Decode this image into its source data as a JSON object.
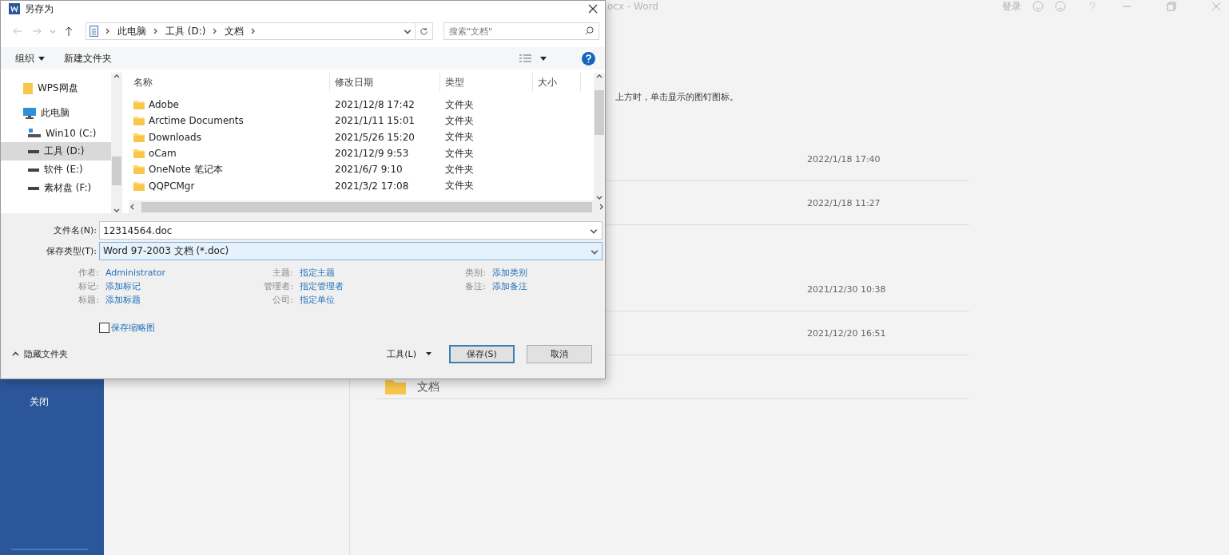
{
  "word_window": {
    "title": "ocx - Word",
    "sign_in": "登录",
    "hint": "上方时，单击显示的图钉图标。",
    "sidebar": {
      "items": [
        {
          "label": "关闭"
        }
      ]
    },
    "recent": [
      {
        "kind": "item",
        "date": "2022/1/18 17:40"
      },
      {
        "kind": "item",
        "date": "2022/1/18 11:27"
      },
      {
        "kind": "gap"
      },
      {
        "kind": "item",
        "date": "2021/12/30 10:38"
      },
      {
        "kind": "item",
        "date": "2021/12/20 16:51"
      },
      {
        "kind": "folder",
        "name": "文档"
      }
    ]
  },
  "dialog": {
    "title": "另存为",
    "breadcrumb": [
      "此电脑",
      "工具 (D:)",
      "文档"
    ],
    "search": {
      "placeholder": "搜索\"文档\""
    },
    "toolbar": {
      "organize": "组织",
      "new_folder": "新建文件夹"
    },
    "nav": [
      {
        "label": "WPS网盘",
        "kind": "cloud",
        "selected": false
      },
      {
        "label": "此电脑",
        "kind": "pc",
        "selected": false,
        "children": [
          {
            "label": "Win10 (C:)",
            "kind": "system",
            "selected": false
          },
          {
            "label": "工具 (D:)",
            "kind": "drive",
            "selected": true
          },
          {
            "label": "软件 (E:)",
            "kind": "drive",
            "selected": false
          },
          {
            "label": "素材盘 (F:)",
            "kind": "drive",
            "selected": false
          }
        ]
      }
    ],
    "columns": [
      "名称",
      "修改日期",
      "类型",
      "大小"
    ],
    "files": [
      {
        "name": "Adobe",
        "modified": "2021/12/8 17:42",
        "type": "文件夹"
      },
      {
        "name": "Arctime Documents",
        "modified": "2021/1/11 15:01",
        "type": "文件夹"
      },
      {
        "name": "Downloads",
        "modified": "2021/5/26 15:20",
        "type": "文件夹"
      },
      {
        "name": "oCam",
        "modified": "2021/12/9 9:53",
        "type": "文件夹"
      },
      {
        "name": "OneNote 笔记本",
        "modified": "2021/6/7 9:10",
        "type": "文件夹"
      },
      {
        "name": "QQPCMgr",
        "modified": "2021/3/2 17:08",
        "type": "文件夹"
      }
    ],
    "file_name": {
      "label": "文件名(N):",
      "value": "12314564.doc"
    },
    "save_type": {
      "label": "保存类型(T):",
      "value": "Word 97-2003 文档 (*.doc)"
    },
    "metadata": [
      [
        {
          "label": "作者:",
          "value": "Administrator"
        },
        {
          "label": "标记:",
          "value": "添加标记"
        },
        {
          "label": "标题:",
          "value": "添加标题"
        }
      ],
      [
        {
          "label": "主题:",
          "value": "指定主题"
        },
        {
          "label": "管理者:",
          "value": "指定管理者"
        },
        {
          "label": "公司:",
          "value": "指定单位"
        }
      ],
      [
        {
          "label": "类别:",
          "value": "添加类别"
        },
        {
          "label": "备注:",
          "value": "添加备注"
        }
      ]
    ],
    "thumbnail": {
      "label": "保存缩略图",
      "checked": false
    },
    "hide_folders": "隐藏文件夹",
    "tools": "工具(L)",
    "buttons": [
      {
        "label": "保存(S)",
        "default": true
      },
      {
        "label": "取消",
        "default": false
      }
    ]
  }
}
